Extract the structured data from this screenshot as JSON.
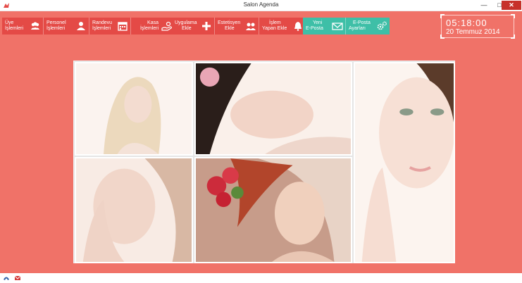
{
  "window": {
    "title": "Salon Agenda",
    "minimize": "—",
    "maximize": "□",
    "close": "✕"
  },
  "toolbar": {
    "group1": [
      {
        "label_line1": "Üye",
        "label_line2": "İşlemleri",
        "icon": "users-icon"
      },
      {
        "label_line1": "Personel",
        "label_line2": "İşlemleri",
        "icon": "user-icon"
      },
      {
        "label_line1": "Randevu",
        "label_line2": "İşlemleri",
        "icon": "calendar-icon"
      },
      {
        "label_line1": "Kasa",
        "label_line2": "İşlemleri",
        "icon": "hand-money-icon"
      }
    ],
    "group2": [
      {
        "label_line1": "Uygulama",
        "label_line2": "Ekle",
        "icon": "plus-icon"
      },
      {
        "label_line1": "Estetisyen",
        "label_line2": "Ekle",
        "icon": "add-users-icon"
      },
      {
        "label_line1": "İşlem",
        "label_line2": "Yapan Ekle",
        "icon": "bell-icon"
      }
    ],
    "group3": [
      {
        "label_line1": "Yeni",
        "label_line2": "E-Posta",
        "icon": "envelope-icon"
      },
      {
        "label_line1": "E-Posta",
        "label_line2": "Ayarları",
        "icon": "gears-icon"
      }
    ]
  },
  "clock": {
    "time": "05:18:00",
    "date": "20 Temmuz 2014"
  },
  "colors": {
    "background": "#f07268",
    "button_red": "#e44a46",
    "button_teal": "#3ebfa7"
  }
}
